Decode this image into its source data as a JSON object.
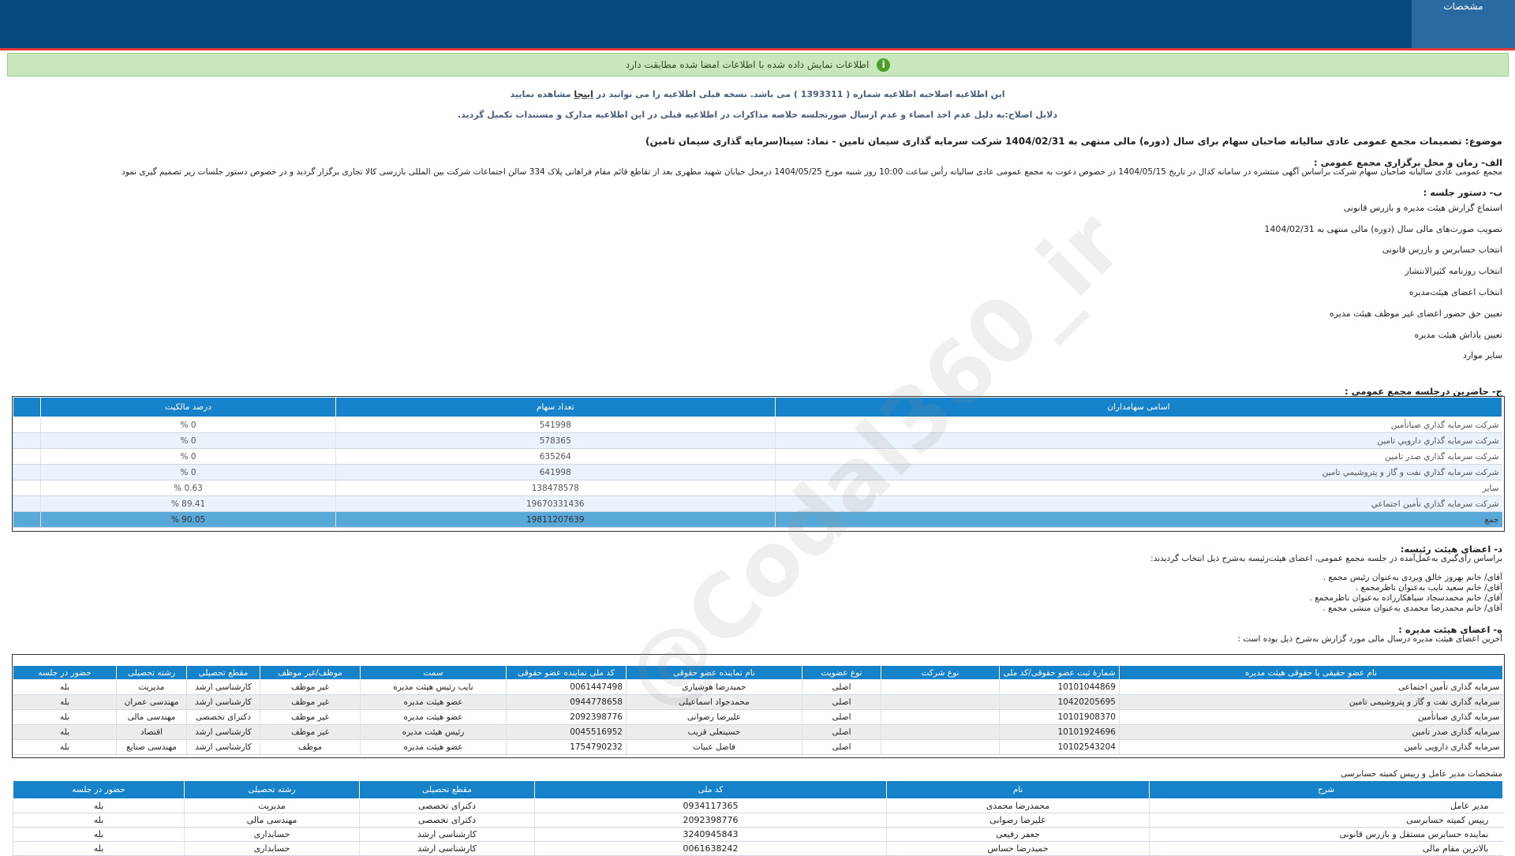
{
  "header": {
    "spec_tab": "مشخصات"
  },
  "verify": {
    "text": "اطلاعات نمایش داده شده با اطلاعات امضا شده مطابقت دارد",
    "icon": "info-icon"
  },
  "notice": {
    "line1_pre": "این اطلاعیه اصلاحیه اطلاعیه شماره ( 1393311 ) می باشد. نسخه قبلی اطلاعیه را می توانید در",
    "line1_link": "اینجا",
    "line1_post": "مشاهده نمایید",
    "line2": "دلایل اصلاح:به دلیل عدم اخذ امضاء و عدم ارسال صورتجلسه خلاصه مذاکرات در اطلاعیه قبلی در این اطلاعیه مدارک و مستندات تکمیل گردید."
  },
  "subject": "موضوع: تصمیمات مجمع عمومی عادی سالیانه صاحبان سهام برای سال (دوره) مالی منتهی به 1404/02/31 شرکت سرمایه گذاری سیمان تامین - نماد: سینا(سرمایه گذاری سیمان تامین)",
  "section_a": {
    "title": "الف- زمان و محل برگزاری مجمع عمومی :",
    "text": "مجمع عمومی عادی سالیانه صاحبان سهام شرکت براساس آگهی منتشره در سامانه کدال در تاریخ 1404/05/15 در خصوص دعوت به مجمع عمومی عادی سالیانه رأس ساعت 10:00 روز شنبه مورخ 1404/05/25 درمحل خیابان شهید مطهری بعد از تقاطع قائم مقام فراهانی پلاک 334 سالن اجتماعات شرکت بین المللی بازرسی کالا تجاری برگزار گردید و در خصوص دستور جلسات زیر تصمیم گیری نمود"
  },
  "section_b": {
    "title": "ب- دستور جلسه :",
    "items": [
      "استماع گزارش هيئت مديره و بازرس قانونی",
      "تصویب صورت‌های مالی سال (دوره) مالی منتهی به 1404/02/31",
      "انتخاب حسابرس و بازرس قانونی",
      "انتخاب روزنامه کثیرالانتشار",
      "انتخاب اعضای هیئت‌مدیره",
      "تعیین حق حضور اعضای غیر موظف هیئت مدیره",
      "تعیین پاداش هیئت مدیره",
      "سایر موارد"
    ]
  },
  "section_c": {
    "title": "ج- حاضرین درجلسه مجمع عمومی :",
    "headers": [
      "اسامی سهامداران",
      "تعداد سهام",
      "درصد مالکیت"
    ],
    "rows": [
      [
        "شرکت سرمايه گذاري صباتأمين",
        "541998",
        "0 %"
      ],
      [
        "شرکت سرمايه گذاري دارويي تامين",
        "578365",
        "0 %"
      ],
      [
        "شرکت سرمايه گذاري صدر تامين",
        "635264",
        "0 %"
      ],
      [
        "شرکت سرمايه گذاري نفت و گاز و پتروشيمي تامين",
        "641998",
        "0 %"
      ],
      [
        "سایر",
        "138478578",
        "0.63 %"
      ],
      [
        "شرکت سرمايه گذاري تأمين اجتماعي",
        "19670331436",
        "89.41 %"
      ]
    ],
    "total": [
      "جمع",
      "19811207639",
      "90.05 %"
    ]
  },
  "section_d": {
    "title": "د- اعضای هیئت رئیسه:",
    "intro": "براساس رأی‌گیری به‌عمل‌آمده در جلسه مجمع عمومی، اعضای هیئت‌رئیسه به‌شرح ذیل انتخاب گردیدند:",
    "lines": [
      "آقای/ خانم بهروز خالق ویردی به‌عنوان رئیس مجمع .",
      "آقای/ خانم سعید نایب به‌عنوان ناظرمجمع .",
      "آقای/ خانم محمدسجاد سیاهکارزاده به‌عنوان ناظرمجمع .",
      "آقای/ خانم محمدرضا محمدی به‌عنوان منشی مجمع ."
    ]
  },
  "section_e": {
    "title": "ه- اعضای هیئت مدیره :",
    "intro": "آخرین اعضای هیئت مدیره درسال مالی مورد گزارش به‌شرح ذیل بوده است :",
    "headers": [
      "نام عضو حقیقی یا حقوقی هیئت مدیره",
      "شمارۀ ثبت عضو حقوقی/کد ملی",
      "نوع شرکت",
      "نوع عضویت",
      "نام نماینده عضو حقوقی",
      "کد ملی نماینده عضو حقوقی",
      "سمت",
      "موظف/غیر موظف",
      "مقطع تحصیلی",
      "رشته تحصیلی",
      "حضور در جلسه"
    ],
    "rows": [
      [
        "سرمایه گذاری تأمین اجتماعی",
        "10101044869",
        "",
        "اصلی",
        "حمیدرضا هوشیاری",
        "0061447498",
        "نایب رئیس هیئت مدیره",
        "غیر موظف",
        "کارشناسی ارشد",
        "مدیریت",
        "بله"
      ],
      [
        "سرمایه گذاری نفت و گاز و پتروشیمی تامین",
        "10420205695",
        "",
        "اصلی",
        "محمدجواد اسماعیلی",
        "0944778658",
        "عضو هیئت مدیره",
        "غیر موظف",
        "کارشناسی ارشد",
        "مهندسی عمران",
        "بله"
      ],
      [
        "سرمایه گذاری صباتأمین",
        "10101908370",
        "",
        "اصلی",
        "علیرضا رضوانی",
        "2092398776",
        "عضو هیئت مدیره",
        "غیر موظف",
        "دکترای تخصصی",
        "مهندسی مالی",
        "بله"
      ],
      [
        "سرمایه گذاری صدر تامین",
        "10101924696",
        "",
        "اصلی",
        "حسینعلی قریب",
        "0045516952",
        "رئیس هیئت مدیره",
        "غیر موظف",
        "کارشناسی ارشد",
        "اقتصاد",
        "بله"
      ],
      [
        "سرمایه گذاری دارویی تامین",
        "10102543204",
        "",
        "اصلی",
        "فاضل عبیات",
        "1754790232",
        "عضو هیئت مدیره",
        "موظف",
        "کارشناسی ارشد",
        "مهندسی صنایع",
        "بله"
      ]
    ]
  },
  "section_f": {
    "title": "مشخصات مدیر عامل و رییس کمیته حسابرسی",
    "headers": [
      "شرح",
      "نام",
      "کد ملی",
      "مقطع تحصیلی",
      "رشته تحصیلی",
      "حضور در جلسه"
    ],
    "rows": [
      [
        "مدیر عامل",
        "محمدرضا محمدی",
        "0934117365",
        "دکترای تخصصی",
        "مدیریت",
        "بله"
      ],
      [
        "رییس کمیته حسابرسی",
        "علیرضا رضوانی",
        "2092398776",
        "دکترای تخصصی",
        "مهندسی مالی",
        "بله"
      ],
      [
        "نماینده حسابرس مستقل و بازرس قانونی",
        "جعفر رفیعی",
        "3240945843",
        "کارشناسی ارشد",
        "حسابداری",
        "بله"
      ],
      [
        "بالاترین مقام مالی",
        "حمیدرضا حساس",
        "0061638242",
        "کارشناسی ارشد",
        "حسابداری",
        "بله"
      ]
    ]
  },
  "watermark": "@Codal360_ir"
}
